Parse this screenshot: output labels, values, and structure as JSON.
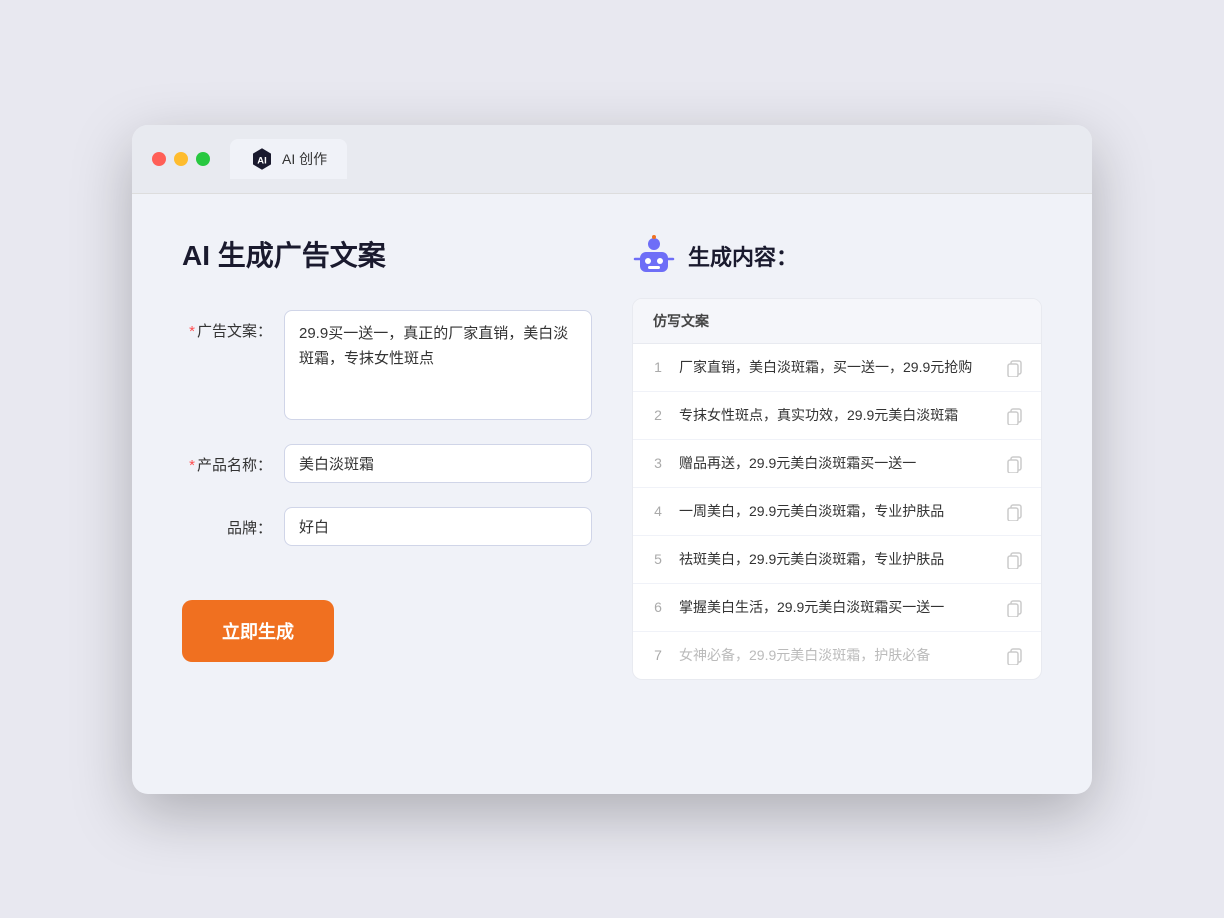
{
  "browser": {
    "tab_title": "AI 创作"
  },
  "page": {
    "title": "AI 生成广告文案",
    "right_title": "生成内容："
  },
  "form": {
    "ad_copy_label": "广告文案：",
    "ad_copy_required": true,
    "ad_copy_value": "29.9买一送一，真正的厂家直销，美白淡斑霜，专抹女性斑点",
    "product_name_label": "产品名称：",
    "product_name_required": true,
    "product_name_value": "美白淡斑霜",
    "brand_label": "品牌：",
    "brand_required": false,
    "brand_value": "好白",
    "generate_btn": "立即生成"
  },
  "table": {
    "header": "仿写文案",
    "rows": [
      {
        "num": "1",
        "text": "厂家直销，美白淡斑霜，买一送一，29.9元抢购",
        "faded": false
      },
      {
        "num": "2",
        "text": "专抹女性斑点，真实功效，29.9元美白淡斑霜",
        "faded": false
      },
      {
        "num": "3",
        "text": "赠品再送，29.9元美白淡斑霜买一送一",
        "faded": false
      },
      {
        "num": "4",
        "text": "一周美白，29.9元美白淡斑霜，专业护肤品",
        "faded": false
      },
      {
        "num": "5",
        "text": "祛斑美白，29.9元美白淡斑霜，专业护肤品",
        "faded": false
      },
      {
        "num": "6",
        "text": "掌握美白生活，29.9元美白淡斑霜买一送一",
        "faded": false
      },
      {
        "num": "7",
        "text": "女神必备，29.9元美白淡斑霜，护肤必备",
        "faded": true
      }
    ]
  }
}
